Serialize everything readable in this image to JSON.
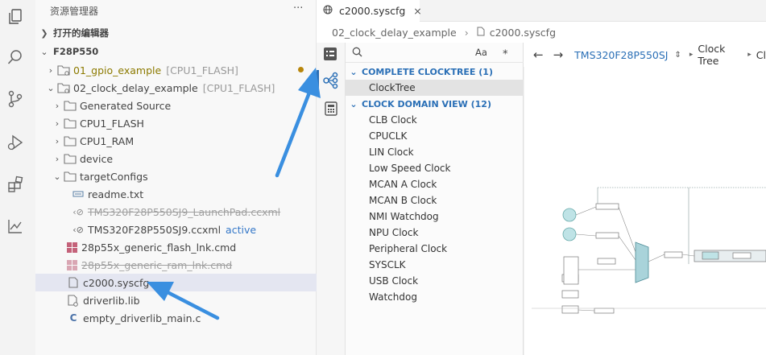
{
  "explorer": {
    "title": "资源管理器",
    "more": "···",
    "open_editors": "打开的编辑器",
    "project": "F28P550",
    "items": [
      {
        "label": "01_gpio_example",
        "tag": "[CPU1_FLASH]"
      },
      {
        "label": "02_clock_delay_example",
        "tag": "[CPU1_FLASH]"
      },
      {
        "label": "Generated Source"
      },
      {
        "label": "CPU1_FLASH"
      },
      {
        "label": "CPU1_RAM"
      },
      {
        "label": "device"
      },
      {
        "label": "targetConfigs"
      },
      {
        "label": "readme.txt"
      },
      {
        "label": "TMS320F28P550SJ9_LaunchPad.ccxml"
      },
      {
        "label": "TMS320F28P550SJ9.ccxml",
        "tag": "active"
      },
      {
        "label": "28p55x_generic_flash_lnk.cmd"
      },
      {
        "label": "28p55x_generic_ram_lnk.cmd"
      },
      {
        "label": "c2000.syscfg"
      },
      {
        "label": "driverlib.lib"
      },
      {
        "label": "empty_driverlib_main.c"
      }
    ]
  },
  "editor": {
    "tab_title": "c2000.syscfg",
    "close": "×",
    "breadcrumb": [
      "02_clock_delay_example",
      "c2000.syscfg"
    ]
  },
  "clock_panel": {
    "font_toggle": "Aa",
    "complete_header": "COMPLETE CLOCKTREE (1)",
    "complete_items": [
      "ClockTree"
    ],
    "domain_header": "CLOCK DOMAIN VIEW (12)",
    "domain_items": [
      "CLB Clock",
      "CPUCLK",
      "LIN Clock",
      "Low Speed Clock",
      "MCAN A Clock",
      "MCAN B Clock",
      "NMI Watchdog",
      "NPU Clock",
      "Peripheral Clock",
      "SYSCLK",
      "USB Clock",
      "Watchdog"
    ]
  },
  "tree_nav": {
    "device": "TMS320F28P550SJ",
    "crumb1": "Clock Tree",
    "crumb2": "Cl"
  },
  "colors": {
    "accent": "#2a6fb6",
    "arrow": "#3a8fe0",
    "modified_dot": "#b8860b"
  }
}
